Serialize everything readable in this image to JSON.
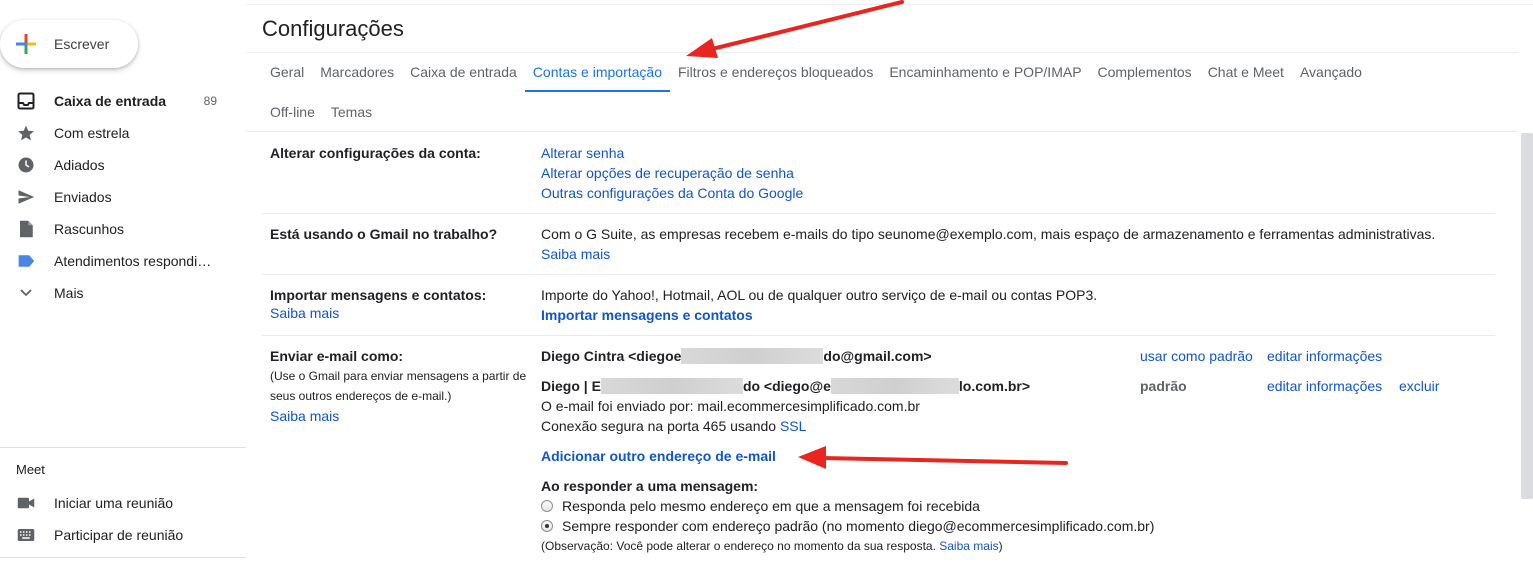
{
  "sidebar": {
    "compose_label": "Escrever",
    "items": [
      {
        "label": "Caixa de entrada",
        "count": "89",
        "icon": "inbox-icon",
        "active": true
      },
      {
        "label": "Com estrela",
        "icon": "star-icon"
      },
      {
        "label": "Adiados",
        "icon": "clock-icon"
      },
      {
        "label": "Enviados",
        "icon": "send-icon"
      },
      {
        "label": "Rascunhos",
        "icon": "draft-icon"
      },
      {
        "label": "Atendimentos respondi…",
        "icon": "label-icon"
      },
      {
        "label": "Mais",
        "icon": "chevron-down-icon"
      }
    ],
    "meet": {
      "title": "Meet",
      "items": [
        {
          "label": "Iniciar uma reunião",
          "icon": "video-icon"
        },
        {
          "label": "Participar de reunião",
          "icon": "keyboard-icon"
        }
      ]
    }
  },
  "page": {
    "title": "Configurações"
  },
  "tabs": {
    "row1": [
      "Geral",
      "Marcadores",
      "Caixa de entrada",
      "Contas e importação",
      "Filtros e endereços bloqueados",
      "Encaminhamento e POP/IMAP",
      "Complementos",
      "Chat e Meet",
      "Avançado"
    ],
    "row2": [
      "Off-line",
      "Temas"
    ],
    "active": "Contas e importação"
  },
  "settings": {
    "account": {
      "label": "Alterar configurações da conta:",
      "links": [
        "Alterar senha",
        "Alterar opções de recuperação de senha",
        "Outras configurações da Conta do Google"
      ]
    },
    "work": {
      "label": "Está usando o Gmail no trabalho?",
      "text": "Com o G Suite, as empresas recebem e-mails do tipo seunome@exemplo.com, mais espaço de armazenamento e ferramentas administrativas.",
      "link": "Saiba mais"
    },
    "import": {
      "label": "Importar mensagens e contatos:",
      "learn_more": "Saiba mais",
      "text": "Importe do Yahoo!, Hotmail, AOL ou de qualquer outro serviço de e-mail ou contas POP3.",
      "action": "Importar mensagens e contatos"
    },
    "send_as": {
      "label": "Enviar e-mail como:",
      "desc_line1": "(Use o Gmail para enviar mensagens a partir de",
      "desc_line2": "seus outros endereços de e-mail.)",
      "learn_more": "Saiba mais",
      "address1": {
        "part1": "Diego Cintra <diegoe",
        "part2": "do@gmail.com>",
        "make_default": "usar como padrão",
        "edit": "editar informações"
      },
      "address2": {
        "part1": "Diego | E",
        "part2": "do <diego@e",
        "part3": "lo.com.br>",
        "default_label": "padrão",
        "edit": "editar informações",
        "delete": "excluir"
      },
      "sent_by": "O e-mail foi enviado por: mail.ecommercesimplificado.com.br",
      "secure_prefix": "Conexão segura na porta 465 usando",
      "secure_link": "SSL",
      "add_address": "Adicionar outro endereço de e-mail",
      "reply_title": "Ao responder a uma mensagem:",
      "reply_opt1": "Responda pelo mesmo endereço em que a mensagem foi recebida",
      "reply_opt2": "Sempre responder com endereço padrão (no momento diego@ecommercesimplificado.com.br)",
      "note_prefix": "(Observação: Você pode alterar o endereço no momento da sua resposta.",
      "note_link": "Saiba mais",
      "note_suffix": ")"
    }
  },
  "colors": {
    "link": "#1155cc",
    "active_tab": "#1a73e8",
    "annotation_arrow": "#e8261f"
  }
}
